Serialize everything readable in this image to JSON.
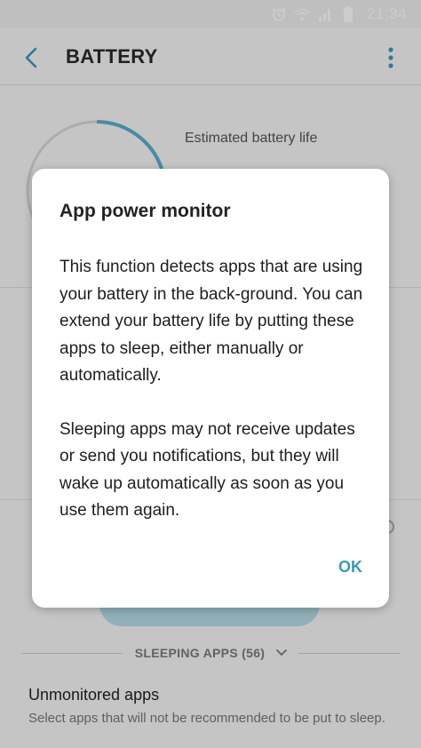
{
  "status_bar": {
    "time": "21:34",
    "icons": [
      "alarm-icon",
      "wifi-icon",
      "signal-icon",
      "battery-icon"
    ]
  },
  "app_bar": {
    "title": "BATTERY",
    "back_icon": "chevron-left-icon",
    "menu_icon": "more-vert-icon"
  },
  "battery": {
    "estimated_label": "Estimated battery life"
  },
  "sleeping_apps": {
    "label": "SLEEPING APPS (56)"
  },
  "unmonitored": {
    "title": "Unmonitored apps",
    "description": "Select apps that will not be recommended to be put to sleep."
  },
  "dialog": {
    "title": "App power monitor",
    "paragraph1": "This function detects apps that are using your battery in the back-ground. You can extend your battery life by putting these apps to sleep, either manually or automatically.",
    "paragraph2": "Sleeping apps may not receive updates or send you notifications, but they will wake up automatically as soon as you use them again.",
    "ok_label": "OK"
  },
  "colors": {
    "accent": "#3a9ab6",
    "ring": "#5aaed0",
    "button_bg": "#b6dde8"
  }
}
